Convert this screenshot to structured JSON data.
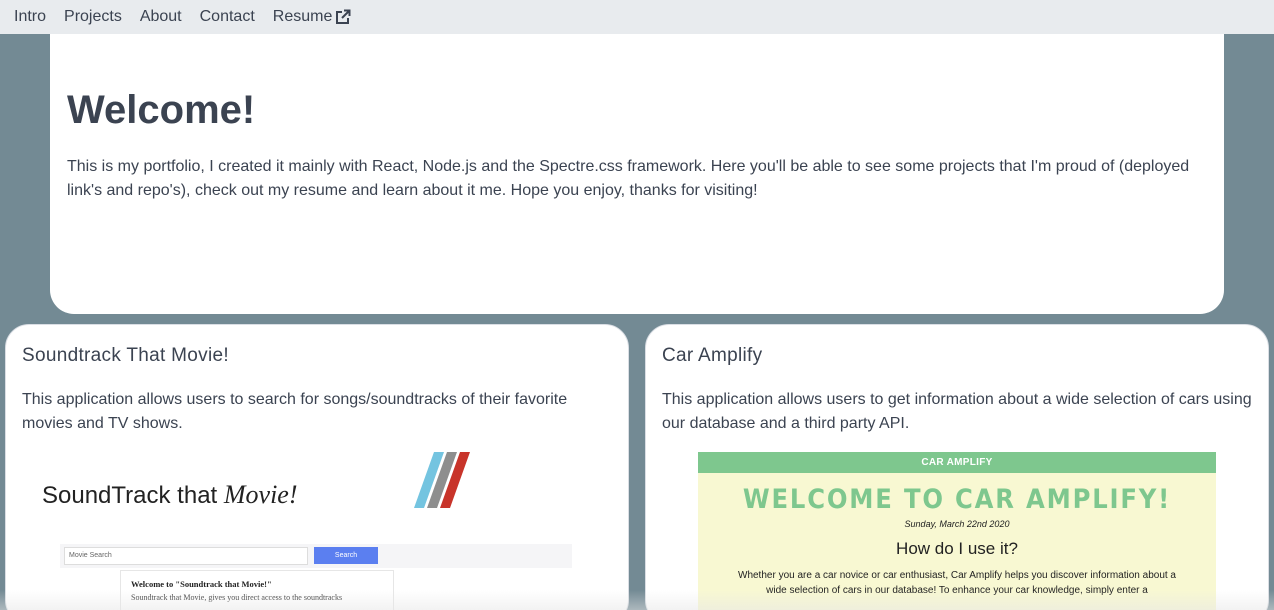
{
  "nav": {
    "items": [
      {
        "label": "Intro"
      },
      {
        "label": "Projects"
      },
      {
        "label": "About"
      },
      {
        "label": "Contact"
      },
      {
        "label": "Resume",
        "icon": "external-link-icon"
      }
    ]
  },
  "hero": {
    "title": "Welcome!",
    "text": "This is my portfolio, I created it mainly with React, Node.js and the Spectre.css framework. Here you'll be able to see some projects that I'm proud of (deployed link's and repo's), check out my resume and learn about it me. Hope you enjoy, thanks for visiting!"
  },
  "projects": [
    {
      "title": "Soundtrack That Movie!",
      "description": "This application allows users to search for songs/soundtracks of their favorite movies and TV shows.",
      "preview": {
        "brand_plain": "SoundTrack that ",
        "brand_italic": "Movie!",
        "search_placeholder": "Movie Search",
        "search_button": "Search",
        "box_title": "Welcome to \"Soundtrack that Movie!\"",
        "box_text": "Soundtrack that Movie, gives you direct access to the soundtracks"
      }
    },
    {
      "title": "Car Amplify",
      "description": "This application allows users to get information about a wide selection of cars using our database and a third party API.",
      "preview": {
        "topbar": "CAR AMPLIFY",
        "heading": "WELCOME TO CAR AMPLIFY!",
        "date": "Sunday, March 22nd 2020",
        "question": "How do I use it?",
        "text": "Whether you are a car novice or car enthusiast, Car Amplify helps you discover information about a wide selection of cars in our database! To enhance your car knowledge, simply enter a"
      }
    }
  ],
  "colors": {
    "page_bg": "#738a94",
    "nav_bg": "#e8ebee",
    "card_bg": "#ffffff",
    "text": "#3b4351",
    "car_green": "#7ec78e",
    "car_bg": "#f8f8d2",
    "search_button": "#5b7ff0"
  }
}
